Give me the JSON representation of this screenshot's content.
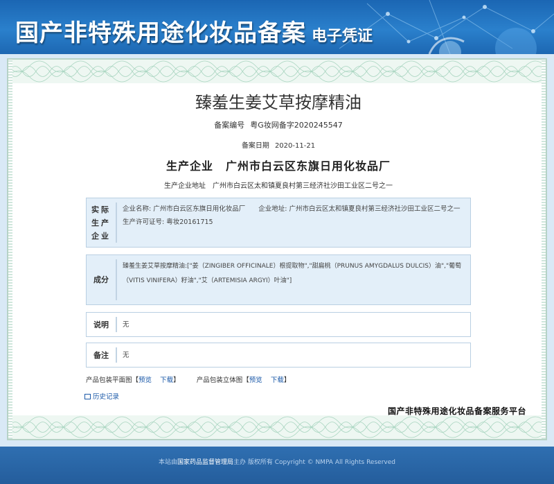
{
  "banner": {
    "title": "国产非特殊用途化妆品备案",
    "subtitle": "电子凭证"
  },
  "certificate": {
    "product_name": "臻羞生姜艾草按摩精油",
    "registration_label": "备案编号",
    "registration_number": "粤G妆网备字2020245547",
    "date_label": "备案日期",
    "date": "2020-11-21",
    "producer_label": "生产企业",
    "producer": "广州市白云区东旗日用化妆品厂",
    "producer_address_label": "生产企业地址",
    "producer_address": "广州市白云区太和镇夏良村第三经济社沙田工业区二号之一"
  },
  "sections": {
    "actual_enterprise": {
      "label": [
        "实际",
        "生产",
        "企业"
      ],
      "content": "企业名称: 广州市白云区东旗日用化妆品厂　　企业地址: 广州市白云区太和镇夏良村第三经济社沙田工业区二号之一　　生产许可证号: 粤妆20161715"
    },
    "ingredients": {
      "label": "成分",
      "content": "臻羞生姜艾草按摩精油:[\"姜（ZINGIBER OFFICINALE）根提取物\",\"甜扁桃（PRUNUS AMYGDALUS DULCIS）油\",\"葡萄（VITIS VINIFERA）籽油\",\"艾（ARTEMISIA ARGYI）叶油\"]"
    },
    "description": {
      "label": "说明",
      "content": "无"
    },
    "remark": {
      "label": "备注",
      "content": "无"
    }
  },
  "packaging": {
    "flat_label": "产品包装平面图【",
    "solid_label": "产品包装立体图【",
    "preview": "预览",
    "download": "下载",
    "close_bracket": "】"
  },
  "history_link": "历史记录",
  "platform_name": "国产非特殊用途化妆品备案服务平台",
  "footer": {
    "prefix": "本站由",
    "org": "国家药品监督管理局",
    "suffix": "主办 版权所有 Copyright © NMPA All Rights Reserved"
  },
  "colors": {
    "banner": "#1b66b3",
    "link": "#1a58a8",
    "box_blue": "#e3eff9",
    "footer": "#2f6fb1"
  }
}
